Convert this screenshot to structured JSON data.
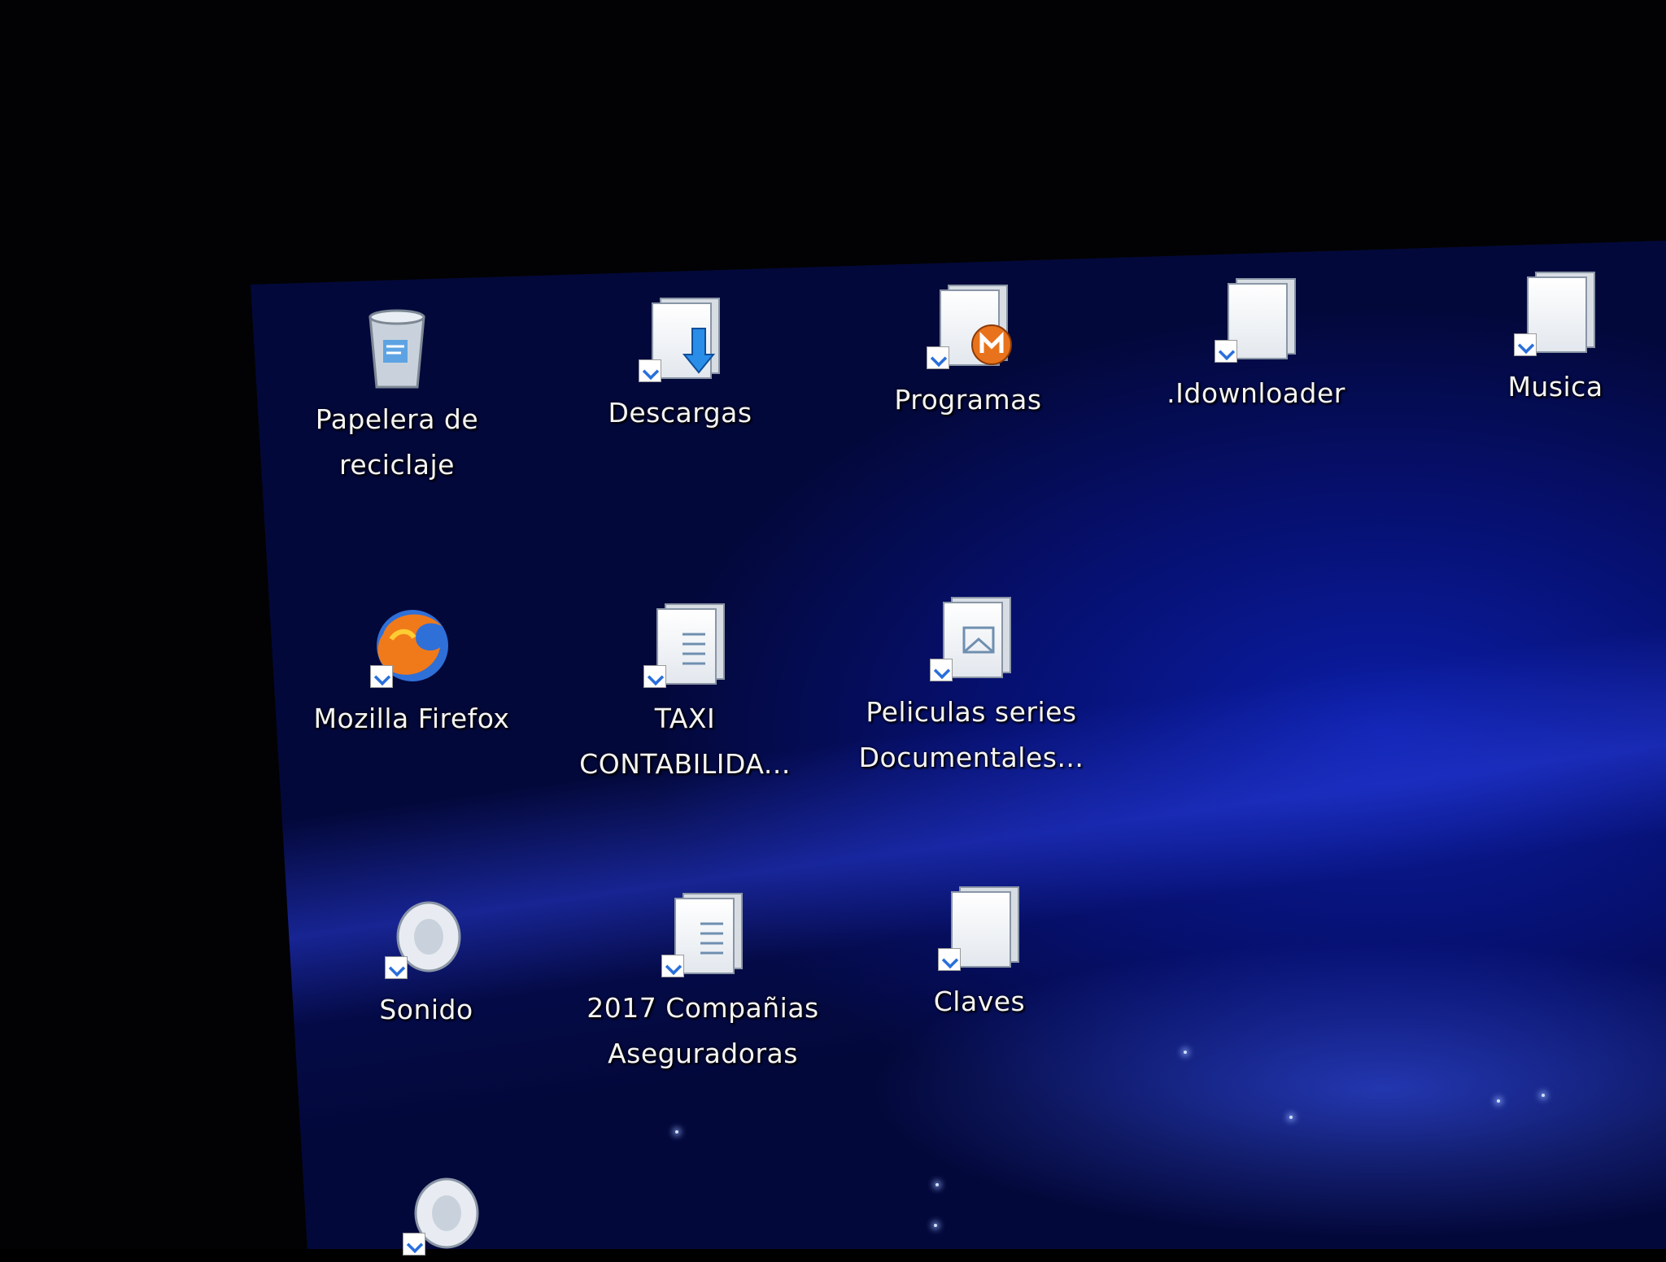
{
  "desktop": {
    "icons": [
      {
        "label_lines": [
          "Papelera de",
          "reciclaje"
        ],
        "icon": "recycle-bin-icon"
      },
      {
        "label_lines": [
          "Descargas"
        ],
        "icon": "downloads-folder-icon"
      },
      {
        "label_lines": [
          "Programas"
        ],
        "icon": "programs-folder-icon"
      },
      {
        "label_lines": [
          ".Idownloader"
        ],
        "icon": "folder-shortcut-icon"
      },
      {
        "label_lines": [
          "Musica"
        ],
        "icon": "folder-shortcut-icon"
      },
      {
        "label_lines": [
          "Mozilla Firefox"
        ],
        "icon": "firefox-icon"
      },
      {
        "label_lines": [
          "TAXI",
          "CONTABILIDA..."
        ],
        "icon": "document-shortcut-icon"
      },
      {
        "label_lines": [
          "Peliculas series",
          "Documentales..."
        ],
        "icon": "document-shortcut-icon"
      },
      {
        "label_lines": [
          "Sonido"
        ],
        "icon": "sound-shortcut-icon"
      },
      {
        "label_lines": [
          "2017 Compañias",
          "Aseguradoras"
        ],
        "icon": "document-shortcut-icon"
      },
      {
        "label_lines": [
          "Claves"
        ],
        "icon": "document-shortcut-icon"
      },
      {
        "label_lines": [],
        "icon": "sound-shortcut-icon"
      }
    ]
  },
  "colors": {
    "label_text": "#f4f4f4",
    "wallpaper_dark": "#03083a",
    "wallpaper_light": "#0b1ea8",
    "firefox_orange": "#f07a1a",
    "programs_badge": "#e8731c",
    "download_arrow": "#2a8de8"
  }
}
